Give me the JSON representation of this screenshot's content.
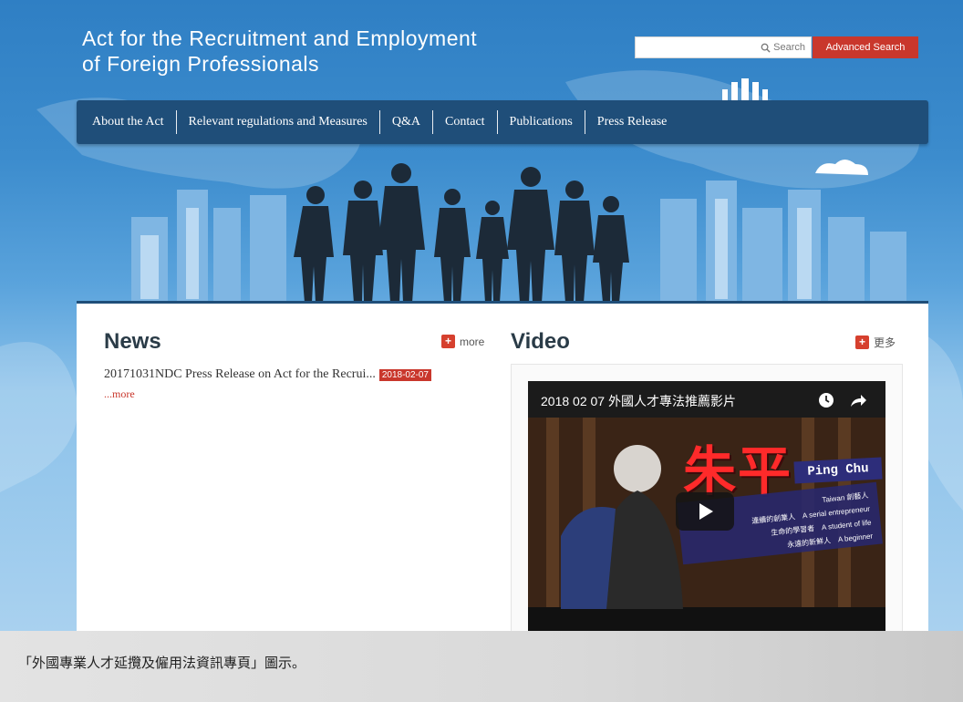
{
  "header": {
    "title_line1": "Act for the Recruitment and Employment",
    "title_line2": "of Foreign Professionals",
    "search_label": "Search",
    "advanced_search_label": "Advanced Search"
  },
  "nav": {
    "items": [
      "About the Act",
      "Relevant regulations and Measures",
      "Q&A",
      "Contact",
      "Publications",
      "Press Release"
    ]
  },
  "news": {
    "title": "News",
    "more_label": "more",
    "items": [
      {
        "title": "20171031NDC Press Release on Act for the Recrui...",
        "date": "2018-02-07"
      }
    ],
    "more_link": "...more"
  },
  "video": {
    "title": "Video",
    "more_label": "更多",
    "caption": "2018 02 07 外國人才專法推薦影片",
    "big_name": "朱平",
    "en_name": "Ping Chu",
    "roles": [
      "Taiwan 創藝人",
      "連續的創業人　A serial entrepreneur",
      "生命的學習者　A student of life",
      "永遠的新鮮人　A beginner"
    ]
  },
  "figure_caption": "「外國專業人才延攬及僱用法資訊專頁」圖示。",
  "colors": {
    "nav_bg": "#1f4e79",
    "accent_red": "#c9372c",
    "sky_top": "#2f7fc4"
  }
}
